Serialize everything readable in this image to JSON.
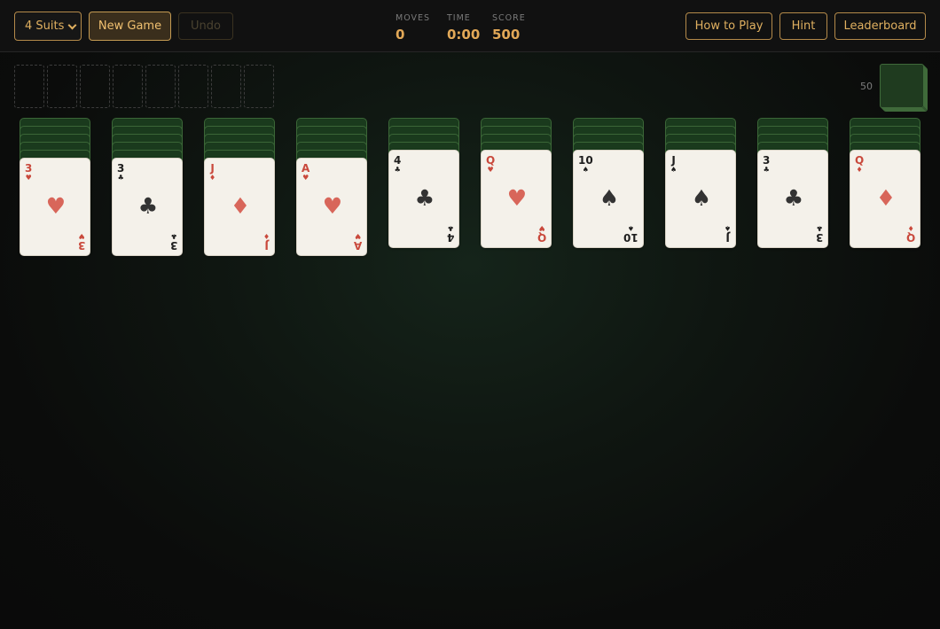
{
  "toolbar": {
    "suit_mode": "4 Suits",
    "new_game_label": "New Game",
    "undo_label": "Undo",
    "how_to_play_label": "How to Play",
    "hint_label": "Hint",
    "leaderboard_label": "Leaderboard"
  },
  "stats": {
    "moves_label": "MOVES",
    "moves_value": "0",
    "time_label": "TIME",
    "time_value": "0:00",
    "score_label": "SCORE",
    "score_value": "500"
  },
  "foundations": {
    "empty_slots": 8
  },
  "stock": {
    "remaining": "50",
    "deal_piles": 5
  },
  "tableau": [
    {
      "facedown": 5,
      "top": {
        "rank": "3",
        "suit": "hearts",
        "symbol": "♥",
        "color": "red"
      }
    },
    {
      "facedown": 5,
      "top": {
        "rank": "3",
        "suit": "clubs",
        "symbol": "♣",
        "color": "black"
      }
    },
    {
      "facedown": 5,
      "top": {
        "rank": "J",
        "suit": "diamonds",
        "symbol": "♦",
        "color": "red"
      }
    },
    {
      "facedown": 5,
      "top": {
        "rank": "A",
        "suit": "hearts",
        "symbol": "♥",
        "color": "red"
      }
    },
    {
      "facedown": 4,
      "top": {
        "rank": "4",
        "suit": "clubs",
        "symbol": "♣",
        "color": "black"
      }
    },
    {
      "facedown": 4,
      "top": {
        "rank": "Q",
        "suit": "hearts",
        "symbol": "♥",
        "color": "red"
      }
    },
    {
      "facedown": 4,
      "top": {
        "rank": "10",
        "suit": "spades",
        "symbol": "♠",
        "color": "black"
      }
    },
    {
      "facedown": 4,
      "top": {
        "rank": "J",
        "suit": "spades",
        "symbol": "♠",
        "color": "black"
      }
    },
    {
      "facedown": 4,
      "top": {
        "rank": "3",
        "suit": "clubs",
        "symbol": "♣",
        "color": "black"
      }
    },
    {
      "facedown": 4,
      "top": {
        "rank": "Q",
        "suit": "diamonds",
        "symbol": "♦",
        "color": "red"
      }
    }
  ]
}
